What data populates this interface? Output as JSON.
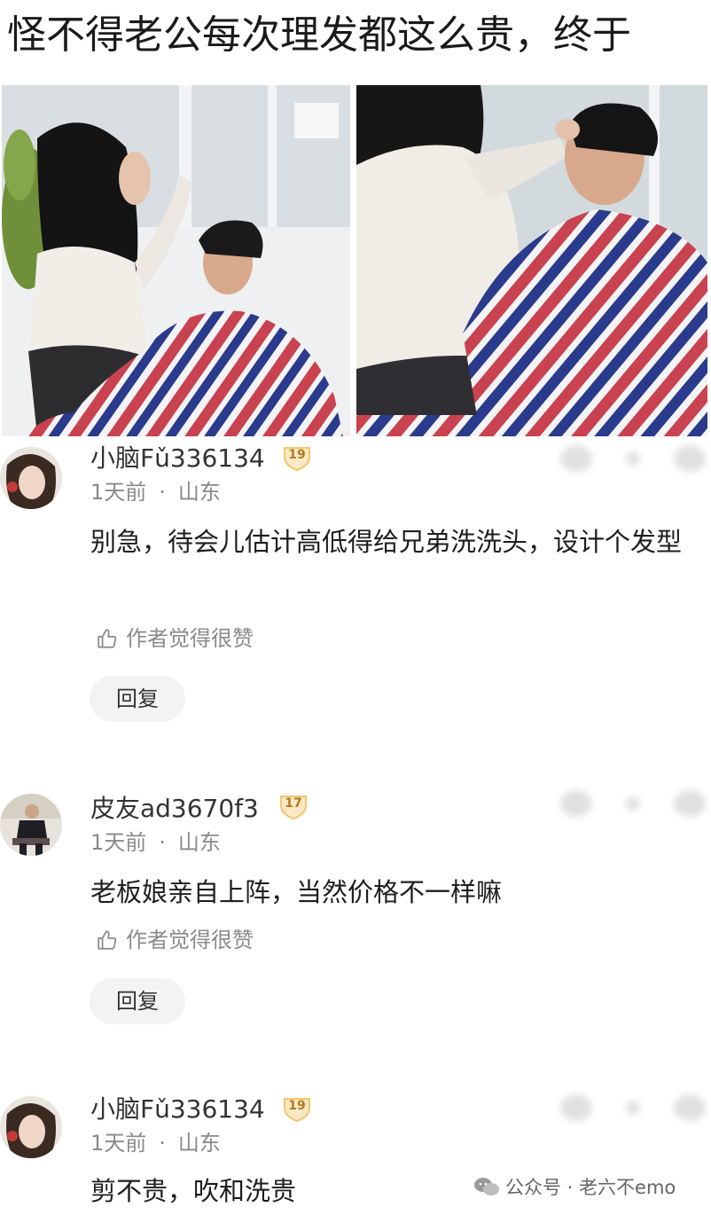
{
  "post": {
    "title": "怪不得老公每次理发都这么贵，终于"
  },
  "comments": [
    {
      "username": "小脑Fǔ336134",
      "level": "19",
      "time": "1天前",
      "location": "山东",
      "content": "别急，待会儿估计高低得给兄弟洗洗头，设计个发型",
      "author_like": "作者觉得很赞",
      "reply_label": "回复"
    },
    {
      "username": "皮友ad3670f3",
      "level": "17",
      "time": "1天前",
      "location": "山东",
      "content": "老板娘亲自上阵，当然价格不一样嘛",
      "author_like": "作者觉得很赞",
      "reply_label": "回复"
    },
    {
      "username": "小脑Fǔ336134",
      "level": "19",
      "time": "1天前",
      "location": "山东",
      "content": "剪不贵，吹和洗贵"
    }
  ],
  "meta_separator": "·",
  "watermark": {
    "text": "公众号 · 老六不emo"
  },
  "colors": {
    "cape_red": "#c9424f",
    "cape_blue": "#2a3a8c",
    "badge_gold": "#f3c66b"
  }
}
